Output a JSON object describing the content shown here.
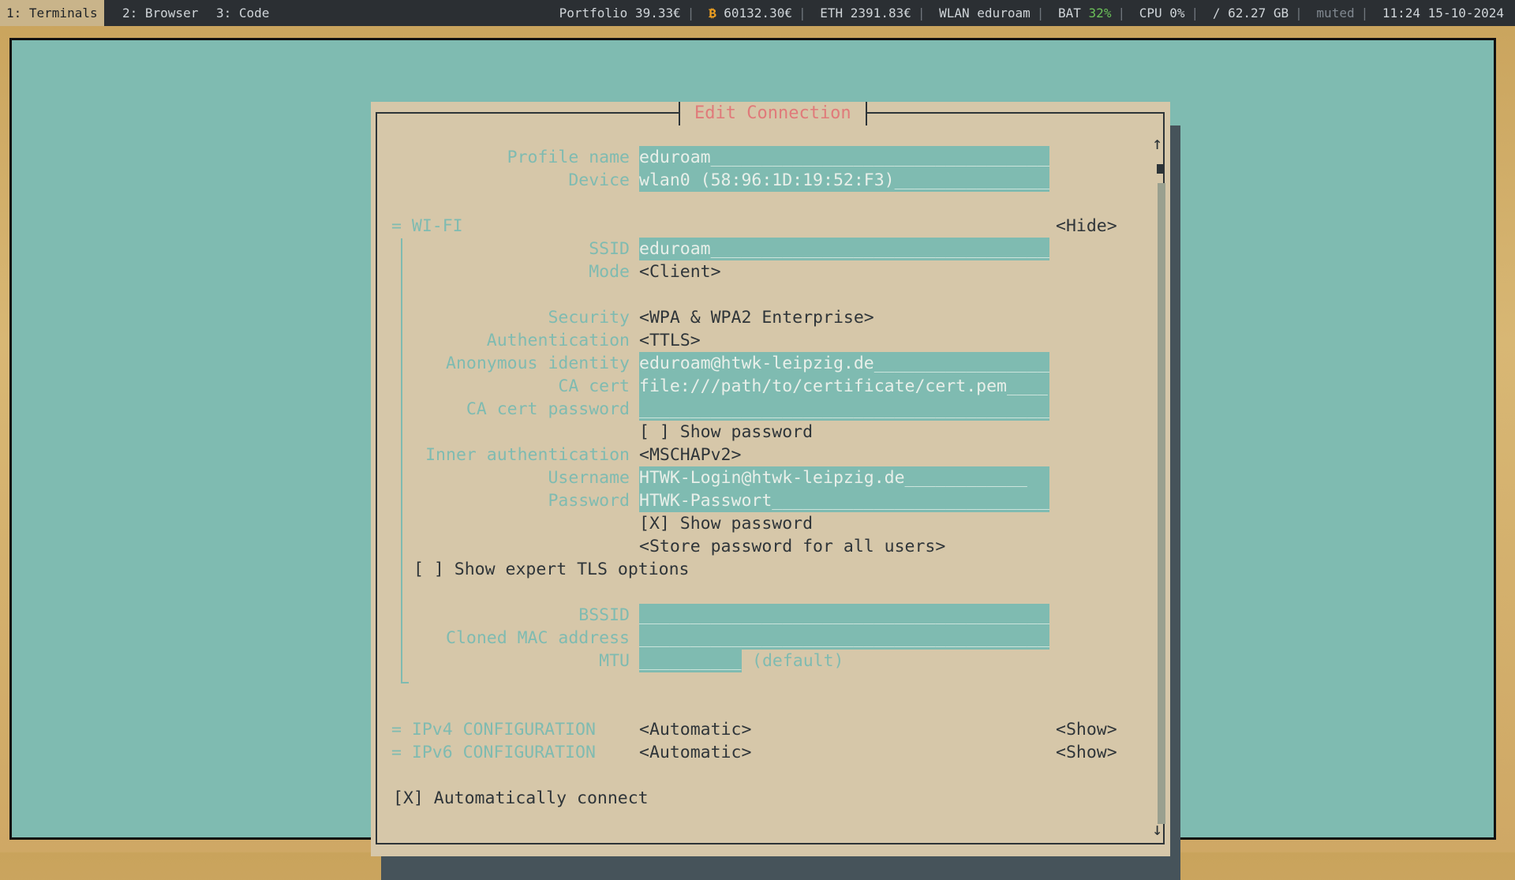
{
  "bar": {
    "workspaces": [
      "1: Terminals",
      "2: Browser",
      "3: Code"
    ],
    "portfolio": "Portfolio 39.33€",
    "btc_icon": "₿",
    "btc": "60132.30€",
    "eth": "ETH 2391.83€",
    "wlan": "WLAN eduroam",
    "bat_label": "BAT",
    "bat_value": "32%",
    "cpu": "CPU  0%",
    "disk": "/ 62.27 GB",
    "volume": "muted",
    "clock": "11:24 15-10-2024"
  },
  "dialog": {
    "title": "Edit Connection",
    "profile_name_label": "Profile name",
    "profile_name_value": "eduroam",
    "device_label": "Device",
    "device_value": "wlan0 (58:96:1D:19:52:F3)",
    "wifi_header": "= WI-FI",
    "hide_button": "<Hide>",
    "ssid_label": "SSID",
    "ssid_value": "eduroam",
    "mode_label": "Mode",
    "mode_value": "<Client>",
    "security_label": "Security",
    "security_value": "<WPA & WPA2 Enterprise>",
    "auth_label": "Authentication",
    "auth_value": "<TTLS>",
    "anon_label": "Anonymous identity",
    "anon_value": "eduroam@htwk-leipzig.de",
    "ca_cert_label": "CA cert",
    "ca_cert_value": "file:///path/to/certificate/cert.pem",
    "ca_pw_label": "CA cert password",
    "ca_pw_value": "",
    "show_pw_1": "[ ] Show password",
    "inner_auth_label": "Inner authentication",
    "inner_auth_value": "<MSCHAPv2>",
    "username_label": "Username",
    "username_value": "HTWK-Login@htwk-leipzig.de",
    "password_label": "Password",
    "password_value": "HTWK-Passwort",
    "show_pw_2": "[X] Show password",
    "store_pw": "<Store password for all users>",
    "expert_tls": "[ ] Show expert TLS options",
    "bssid_label": "BSSID",
    "bssid_value": "",
    "cloned_mac_label": "Cloned MAC address",
    "cloned_mac_value": "",
    "mtu_label": "MTU",
    "mtu_value": "",
    "mtu_default": "(default)",
    "ipv4_header": "= IPv4 CONFIGURATION",
    "ipv4_value": "<Automatic>",
    "ipv4_show": "<Show>",
    "ipv6_header": "= IPv6 CONFIGURATION",
    "ipv6_value": "<Automatic>",
    "ipv6_show": "<Show>",
    "auto_connect": "[X] Automatically connect",
    "scroll_up": "↑",
    "scroll_down": "↓"
  }
}
